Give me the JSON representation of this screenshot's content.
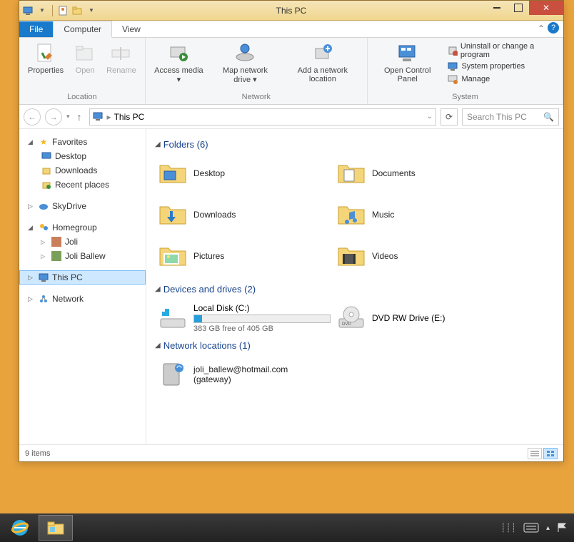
{
  "window": {
    "title": "This PC"
  },
  "tabs": {
    "file": "File",
    "computer": "Computer",
    "view": "View"
  },
  "ribbon": {
    "location": {
      "label": "Location",
      "properties": "Properties",
      "open": "Open",
      "rename": "Rename"
    },
    "network": {
      "label": "Network",
      "access_media": "Access media ▾",
      "map_drive": "Map network drive ▾",
      "add_location": "Add a network location"
    },
    "system": {
      "label": "System",
      "control_panel": "Open Control Panel",
      "uninstall": "Uninstall or change a program",
      "sys_props": "System properties",
      "manage": "Manage"
    }
  },
  "address": {
    "location": "This PC"
  },
  "search": {
    "placeholder": "Search This PC"
  },
  "sidebar": {
    "favorites": "Favorites",
    "desktop": "Desktop",
    "downloads": "Downloads",
    "recent": "Recent places",
    "skydrive": "SkyDrive",
    "homegroup": "Homegroup",
    "hg_user1": "Joli",
    "hg_user2": "Joli Ballew",
    "thispc": "This PC",
    "network": "Network"
  },
  "groups": {
    "folders_header": "Folders (6)",
    "folders": [
      {
        "name": "Desktop"
      },
      {
        "name": "Documents"
      },
      {
        "name": "Downloads"
      },
      {
        "name": "Music"
      },
      {
        "name": "Pictures"
      },
      {
        "name": "Videos"
      }
    ],
    "drives_header": "Devices and drives (2)",
    "local_disk": {
      "name": "Local Disk (C:)",
      "free_text": "383 GB free of 405 GB",
      "percent_used": 6
    },
    "dvd": {
      "name": "DVD RW Drive (E:)"
    },
    "netloc_header": "Network locations (1)",
    "netloc": {
      "name": "joli_ballew@hotmail.com (gateway)"
    }
  },
  "status": {
    "items": "9 items"
  }
}
